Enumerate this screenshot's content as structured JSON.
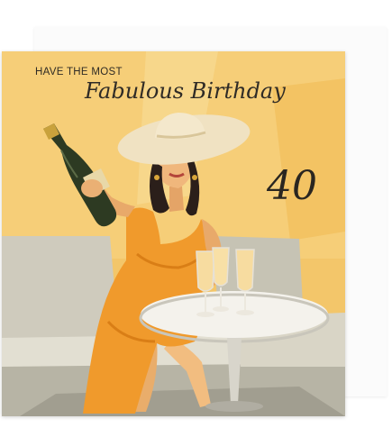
{
  "card": {
    "top_line": "HAVE THE MOST",
    "headline": "Fabulous Birthday",
    "age": "40"
  },
  "colors": {
    "background_yellow": "#f3c66a",
    "wall_light": "#f7d98e",
    "bench_gray": "#c9c7b8",
    "dress_orange": "#f09a2c",
    "hat_cream": "#f0e2c2",
    "table_white": "#f2f0ea",
    "text_dark": "#2f2b26"
  },
  "icons": {
    "scene": "woman-with-champagne-illustration",
    "bottle": "champagne-bottle",
    "glasses": "champagne-flutes"
  }
}
